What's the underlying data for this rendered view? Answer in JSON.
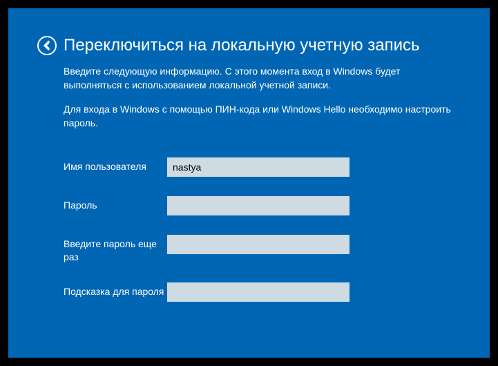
{
  "header": {
    "title": "Переключиться на локальную учетную запись"
  },
  "description": "Введите следующую информацию. С этого момента вход в Windows будет выполняться с использованием локальной учетной записи.",
  "note": "Для входа в Windows с помощью ПИН-кода или Windows Hello необходимо настроить пароль.",
  "form": {
    "username": {
      "label": "Имя пользователя",
      "value": "nastya"
    },
    "password": {
      "label": "Пароль",
      "value": ""
    },
    "password_confirm": {
      "label": "Введите пароль еще раз",
      "value": ""
    },
    "hint": {
      "label": "Подсказка для пароля",
      "value": ""
    }
  }
}
